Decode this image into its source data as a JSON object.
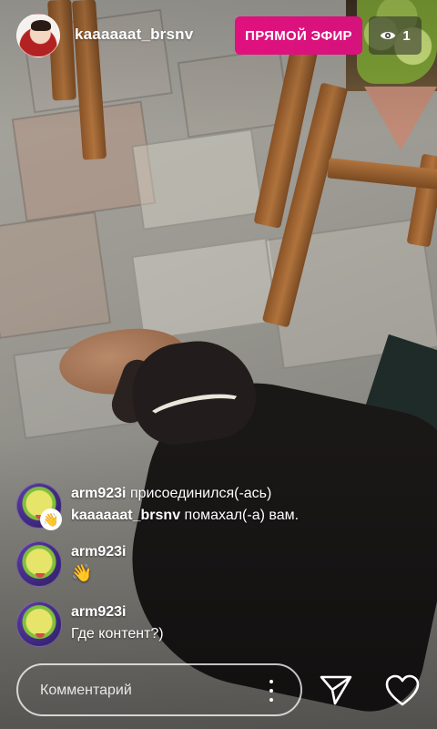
{
  "header": {
    "username": "kaaaaaat_brsnv",
    "live_label": "ПРЯМОЙ ЭФИР",
    "viewer_count": "1"
  },
  "comments": [
    {
      "lines": [
        {
          "user": "arm923i",
          "text": " присоединился(-ась)"
        },
        {
          "user": "kaaaaaat_brsnv",
          "text": " помахал(-а) вам."
        }
      ],
      "badge_icon": "wave-hand-icon"
    },
    {
      "user": "arm923i",
      "text": "👋"
    },
    {
      "user": "arm923i",
      "text": "Где контент?)"
    }
  ],
  "input": {
    "placeholder": "Комментарий"
  },
  "icons": [
    "eye-icon",
    "more-options-icon",
    "send-icon",
    "heart-icon",
    "wave-hand-icon"
  ],
  "colors": {
    "live_badge": "#e0117f"
  }
}
